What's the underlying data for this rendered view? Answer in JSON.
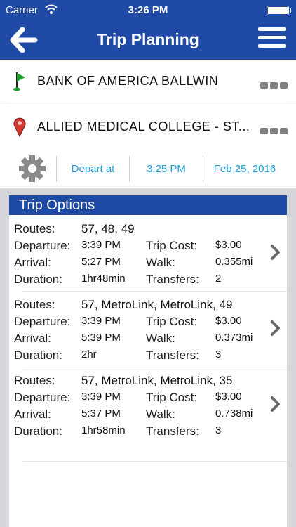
{
  "status": {
    "carrier": "Carrier",
    "time": "3:26 PM"
  },
  "header": {
    "title": "Trip Planning"
  },
  "origin": {
    "name": "BANK OF AMERICA BALLWIN",
    "pin_color": "#1e9e2e"
  },
  "destination": {
    "name": "ALLIED MEDICAL COLLEGE - ST...",
    "pin_color": "#d0352e"
  },
  "options": {
    "depart_mode": "Depart at",
    "time": "3:25 PM",
    "date": "Feb 25, 2016"
  },
  "trip_options": {
    "title": "Trip Options",
    "labels": {
      "routes": "Routes:",
      "departure": "Departure:",
      "arrival": "Arrival:",
      "duration": "Duration:",
      "cost": "Trip Cost:",
      "walk": "Walk:",
      "transfers": "Transfers:"
    },
    "trips": [
      {
        "routes": "57, 48, 49",
        "departure": "3:39 PM",
        "arrival": "5:27 PM",
        "duration": "1hr48min",
        "cost": "$3.00",
        "walk": "0.355mi",
        "transfers": "2"
      },
      {
        "routes": "57, MetroLink, MetroLink, 49",
        "departure": "3:39 PM",
        "arrival": "5:39 PM",
        "duration": "2hr",
        "cost": "$3.00",
        "walk": "0.373mi",
        "transfers": "3"
      },
      {
        "routes": "57, MetroLink, MetroLink, 35",
        "departure": "3:39 PM",
        "arrival": "5:37 PM",
        "duration": "1hr58min",
        "cost": "$3.00",
        "walk": "0.738mi",
        "transfers": "3"
      }
    ]
  },
  "colors": {
    "brand": "#1f4aa6",
    "accent": "#1aa0d6"
  }
}
